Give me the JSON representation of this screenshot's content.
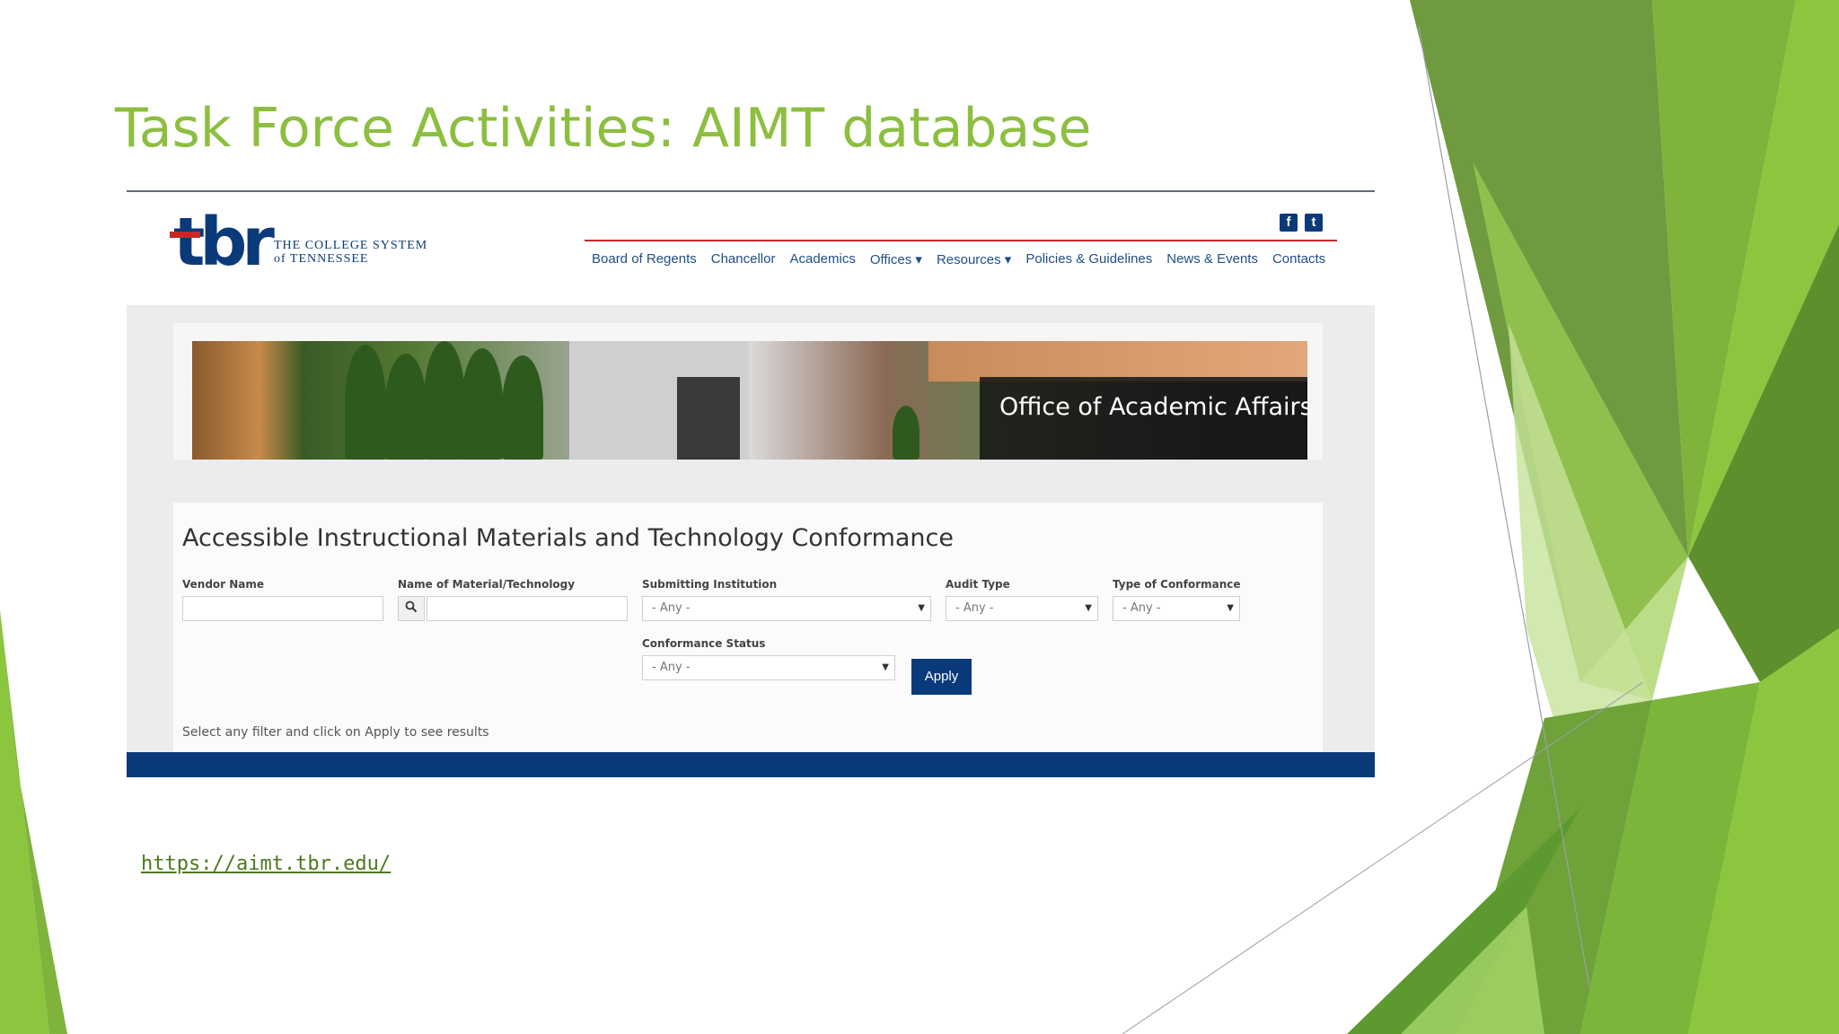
{
  "slide": {
    "title": "Task Force Activities: AIMT database",
    "link": "https://aimt.tbr.edu/",
    "accent_color": "#8cbf3f"
  },
  "screenshot": {
    "logo": {
      "mark": "tbr",
      "line1": "THE COLLEGE SYSTEM",
      "line2": "of TENNESSEE"
    },
    "social": {
      "facebook_icon": "facebook-icon",
      "twitter_icon": "twitter-icon"
    },
    "nav": [
      {
        "label": "Board of Regents"
      },
      {
        "label": "Chancellor"
      },
      {
        "label": "Academics"
      },
      {
        "label": "Offices ▾"
      },
      {
        "label": "Resources ▾"
      },
      {
        "label": "Policies & Guidelines"
      },
      {
        "label": "News & Events"
      },
      {
        "label": "Contacts"
      }
    ],
    "banner": {
      "label": "Office of Academic Affairs"
    },
    "form": {
      "title": "Accessible Instructional Materials and Technology Conformance",
      "vendor_name_label": "Vendor Name",
      "vendor_name_value": "",
      "material_label": "Name of Material/Technology",
      "material_value": "",
      "institution_label": "Submitting Institution",
      "institution_value": "- Any -",
      "audit_type_label": "Audit Type",
      "audit_type_value": "- Any -",
      "conformance_type_label": "Type of Conformance",
      "conformance_type_value": "- Any -",
      "conformance_status_label": "Conformance Status",
      "conformance_status_value": "- Any -",
      "apply_label": "Apply",
      "hint": "Select any filter and click on Apply to see results"
    },
    "brand_color": "#0b3a7a",
    "nav_rule_color": "#c62828"
  }
}
